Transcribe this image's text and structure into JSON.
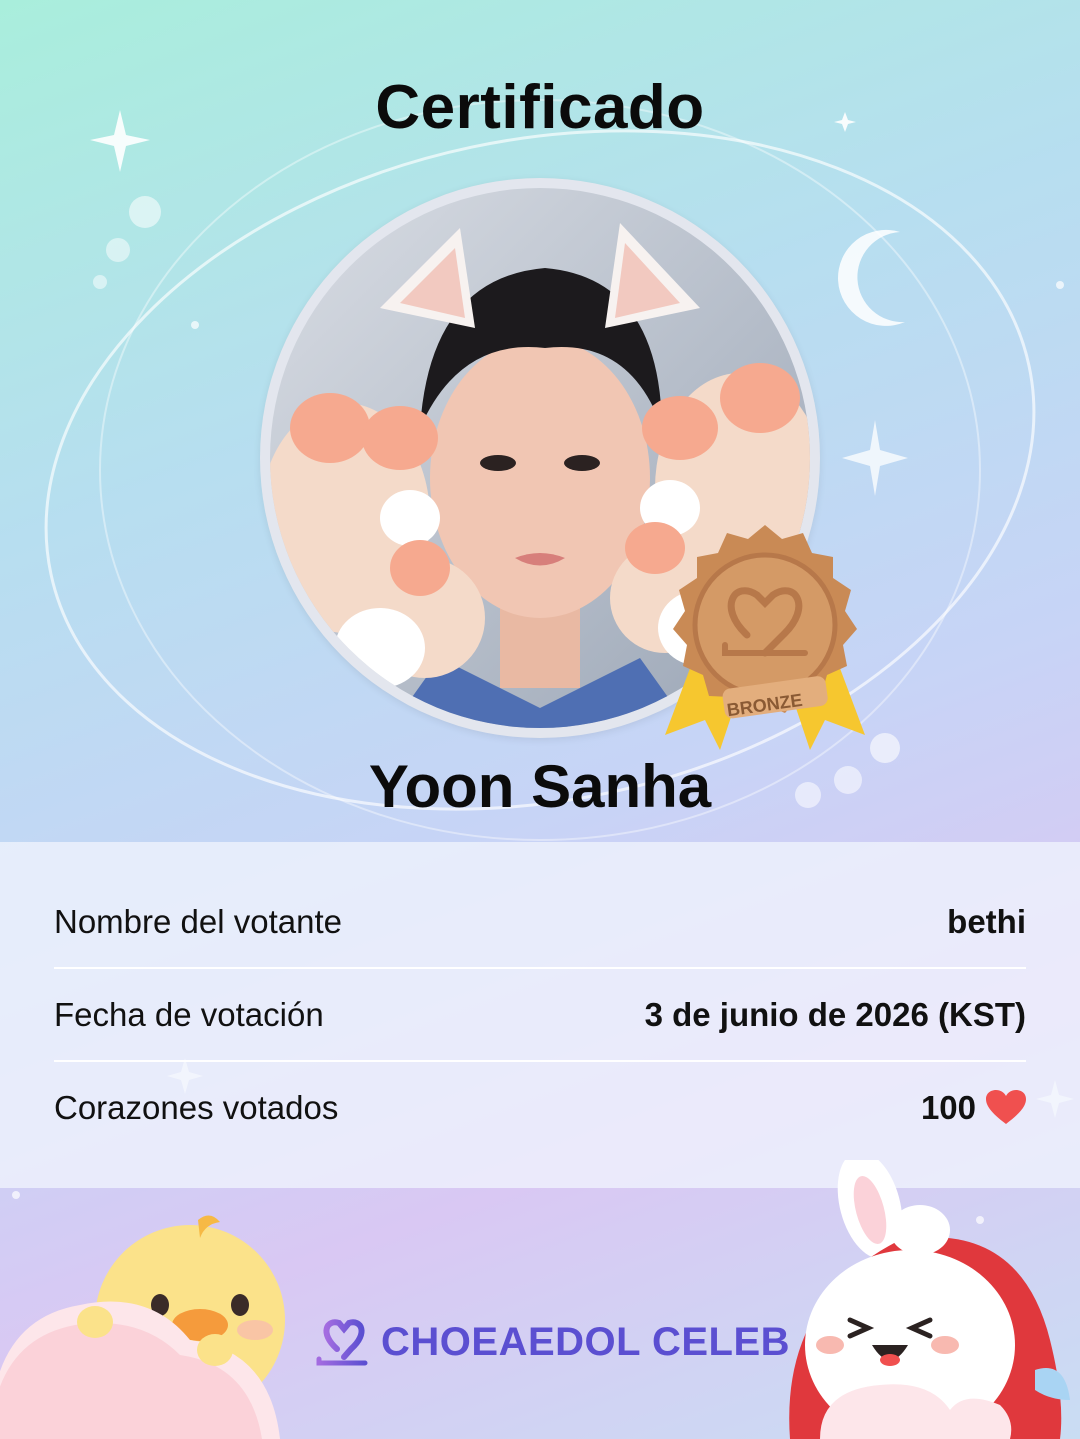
{
  "certificate": {
    "title": "Certificado",
    "idol_name": "Yoon Sanha",
    "badge_label": "BRONZE"
  },
  "details": [
    {
      "label": "Nombre del votante",
      "value": "bethi"
    },
    {
      "label": "Fecha de votación",
      "value": "3 de junio de 2026 (KST)"
    },
    {
      "label": "Corazones votados",
      "value": "100"
    }
  ],
  "footer": {
    "brand": "CHOEAEDOL CELEB"
  },
  "icons": {
    "heart": "heart-icon",
    "medal": "bronze-medal-icon",
    "logo": "choeaedol-logo-icon"
  },
  "colors": {
    "heart": "#f0504f",
    "medal": "#c98a55",
    "brand": "#5b4fd1"
  }
}
